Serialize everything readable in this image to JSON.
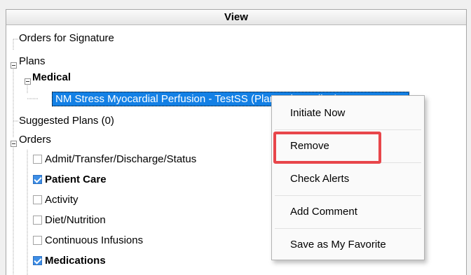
{
  "header": {
    "title": "View"
  },
  "tree": {
    "orders_for_signature": "Orders for Signature",
    "plans": "Plans",
    "medical": "Medical",
    "selected_item": "NM Stress Myocardial Perfusion - TestSS (Planned Pending)",
    "suggested_plans": "Suggested Plans (0)",
    "orders": "Orders",
    "categories": [
      {
        "label": "Admit/Transfer/Discharge/Status",
        "checked": false
      },
      {
        "label": "Patient Care",
        "checked": true
      },
      {
        "label": "Activity",
        "checked": false
      },
      {
        "label": "Diet/Nutrition",
        "checked": false
      },
      {
        "label": "Continuous Infusions",
        "checked": false
      },
      {
        "label": "Medications",
        "checked": true
      }
    ]
  },
  "context_menu": {
    "items": [
      "Initiate Now",
      "Remove",
      "Check Alerts",
      "Add Comment",
      "Save as My Favorite"
    ],
    "highlighted": "Remove",
    "highlight_color": "#e8464b"
  },
  "colors": {
    "selection": "#1380e5"
  }
}
